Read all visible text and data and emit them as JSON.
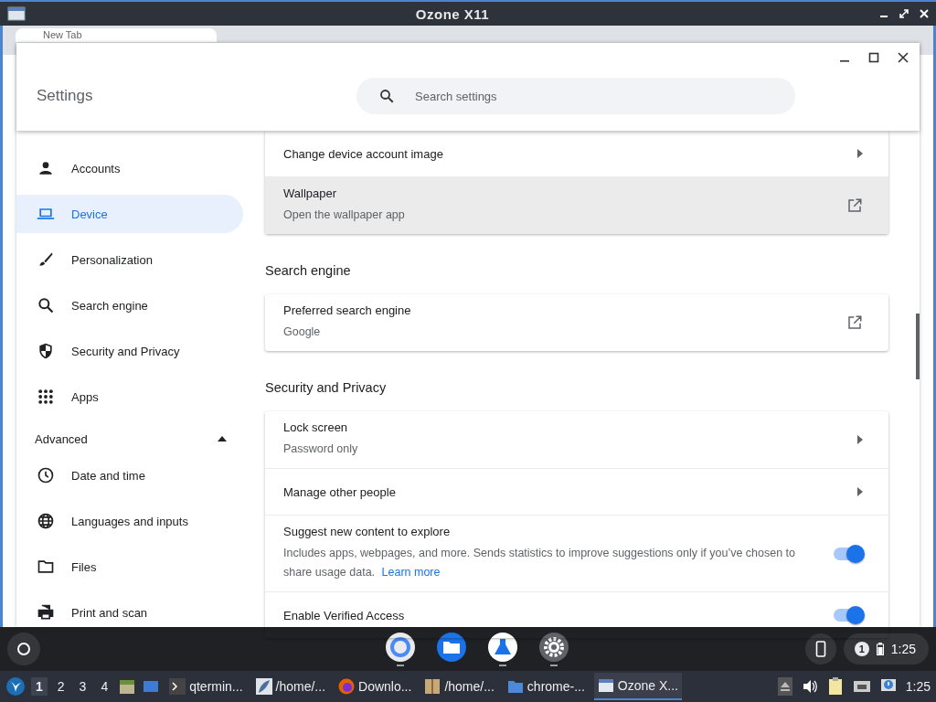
{
  "x11_window": {
    "title": "Ozone X11"
  },
  "browser_tab": {
    "label": "New Tab"
  },
  "settings": {
    "title": "Settings",
    "search": {
      "placeholder": "Search settings"
    },
    "sidebar": {
      "items": [
        {
          "label": "Accounts",
          "selected": false
        },
        {
          "label": "Device",
          "selected": true
        },
        {
          "label": "Personalization",
          "selected": false
        },
        {
          "label": "Search engine",
          "selected": false
        },
        {
          "label": "Security and Privacy",
          "selected": false
        },
        {
          "label": "Apps",
          "selected": false
        }
      ],
      "advanced": {
        "label": "Advanced",
        "expanded": true,
        "items": [
          {
            "label": "Date and time",
            "selected": false
          },
          {
            "label": "Languages and inputs",
            "selected": false
          },
          {
            "label": "Files",
            "selected": false
          },
          {
            "label": "Print and scan",
            "selected": false
          }
        ]
      }
    },
    "sections": [
      {
        "rows": [
          {
            "kind": "link",
            "title": "Change device account image"
          },
          {
            "kind": "external",
            "title": "Wallpaper",
            "subtitle": "Open the wallpaper app",
            "highlighted": true
          }
        ]
      },
      {
        "heading": "Search engine",
        "rows": [
          {
            "kind": "external",
            "title": "Preferred search engine",
            "subtitle": "Google",
            "highlighted": false
          }
        ]
      },
      {
        "heading": "Security and Privacy",
        "rows": [
          {
            "kind": "link",
            "title": "Lock screen",
            "subtitle": "Password only"
          },
          {
            "kind": "link",
            "title": "Manage other people"
          },
          {
            "kind": "toggle",
            "title": "Suggest new content to explore",
            "subtitle": "Includes apps, webpages, and more. Sends statistics to improve suggestions only if you’ve chosen to share usage data.",
            "link": "Learn more",
            "on": true
          },
          {
            "kind": "toggle",
            "title": "Enable Verified Access",
            "on": true
          }
        ]
      }
    ]
  },
  "shelf": {
    "apps": [
      {
        "running": true
      },
      {
        "running": false
      },
      {
        "running": true
      },
      {
        "running": true
      }
    ],
    "notification_count": "1",
    "time": "1:25"
  },
  "taskbar": {
    "workspaces": [
      {
        "label": "1",
        "selected": true
      },
      {
        "label": "2",
        "selected": false
      },
      {
        "label": "3",
        "selected": false
      },
      {
        "label": "4",
        "selected": false
      }
    ],
    "windows": [
      {
        "label": "qtermin...",
        "selected": false
      },
      {
        "label": "/home/...",
        "selected": false
      },
      {
        "label": "Downlo...",
        "selected": false
      },
      {
        "label": "/home/...",
        "selected": false
      },
      {
        "label": "chrome-...",
        "selected": false
      },
      {
        "label": "Ozone X...",
        "selected": true
      }
    ],
    "time": "1:25"
  }
}
